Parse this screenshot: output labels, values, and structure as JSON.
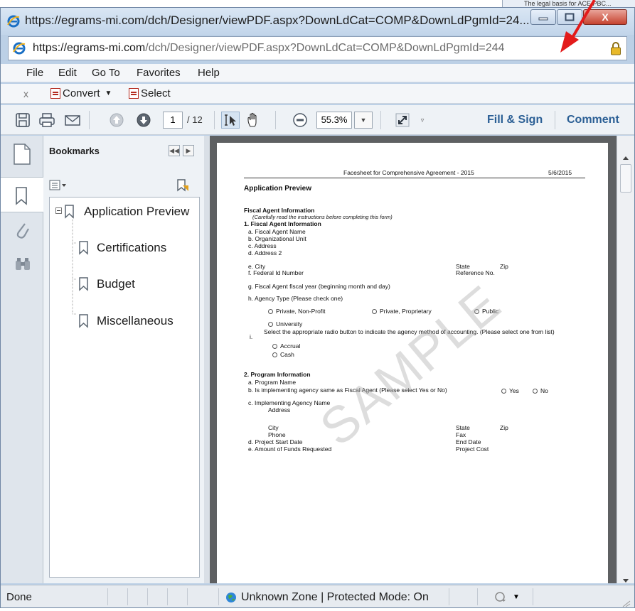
{
  "background": {
    "snippet_text": "The legal basis for ACE PBC..."
  },
  "window": {
    "title": "https://egrams-mi.com/dch/Designer/viewPDF.aspx?DownLdCat=COMP&DownLdPgmId=24...",
    "controls": {
      "minimize": "minimize",
      "maximize": "maximize",
      "close": "X"
    }
  },
  "address": {
    "host": "https://egrams-mi.com",
    "path": "/dch/Designer/viewPDF.aspx?DownLdCat=COMP&DownLdPgmId=244"
  },
  "menu": [
    "File",
    "Edit",
    "Go To",
    "Favorites",
    "Help"
  ],
  "command_bar": {
    "close": "x",
    "convert": "Convert",
    "select": "Select"
  },
  "pdf_toolbar": {
    "page_current": "1",
    "page_total": "/ 12",
    "zoom": "55.3%",
    "fill_sign": "Fill & Sign",
    "comment": "Comment"
  },
  "bookmarks": {
    "title": "Bookmarks",
    "items": [
      "Application Preview",
      "Certifications",
      "Budget",
      "Miscellaneous"
    ]
  },
  "pdf_page": {
    "header": "Facesheet for Comprehensive Agreement - 2015",
    "date": "5/6/2015",
    "heading": "Application Preview",
    "section_title": "Fiscal Agent Information",
    "instruction": "(Carefully read the instructions before completing this form)",
    "section1": "1.  Fiscal Agent Information",
    "rows1": [
      "a.   Fiscal Agent Name",
      "b.   Organizational Unit",
      "c.   Address",
      "d.   Address 2",
      "e.   City",
      "f.    Federal Id Number"
    ],
    "state": "State",
    "zip": "Zip",
    "ref": "Reference No.",
    "g": "g.   Fiscal Agent fiscal year (beginning month and day)",
    "h": "h.   Agency Type (Please check one)",
    "agency_types": [
      "Private, Non-Profit",
      "Private, Proprietary",
      "Public",
      "University"
    ],
    "i_num": "i.",
    "i_text": "Select the appropriate radio button to indicate the agency method of accounting.  (Please select one from list)",
    "accounting": [
      "Accrual",
      "Cash"
    ],
    "section2": "2.  Program Information",
    "p_a": "a.   Program Name",
    "p_b": "b.   Is implementing agency same as Fiscal Agent  (Please select Yes or No)",
    "yes": "Yes",
    "no": "No",
    "p_c": "c.   Implementing Agency Name",
    "p_addr": "Address",
    "p_city": "City",
    "p_state": "State",
    "p_zip": "Zip",
    "p_phone": "Phone",
    "p_fax": "Fax",
    "p_d": "d.   Project Start Date",
    "p_end": "End Date",
    "p_e": "e.   Amount of Funds Requested",
    "p_cost": "Project Cost",
    "watermark": "SAMPLE"
  },
  "status": {
    "left": "Done",
    "zone": "Unknown Zone | Protected Mode: On"
  },
  "colors": {
    "accent": "#2b5f95",
    "arrow": "#e31b1b",
    "close": "#c6432f"
  }
}
